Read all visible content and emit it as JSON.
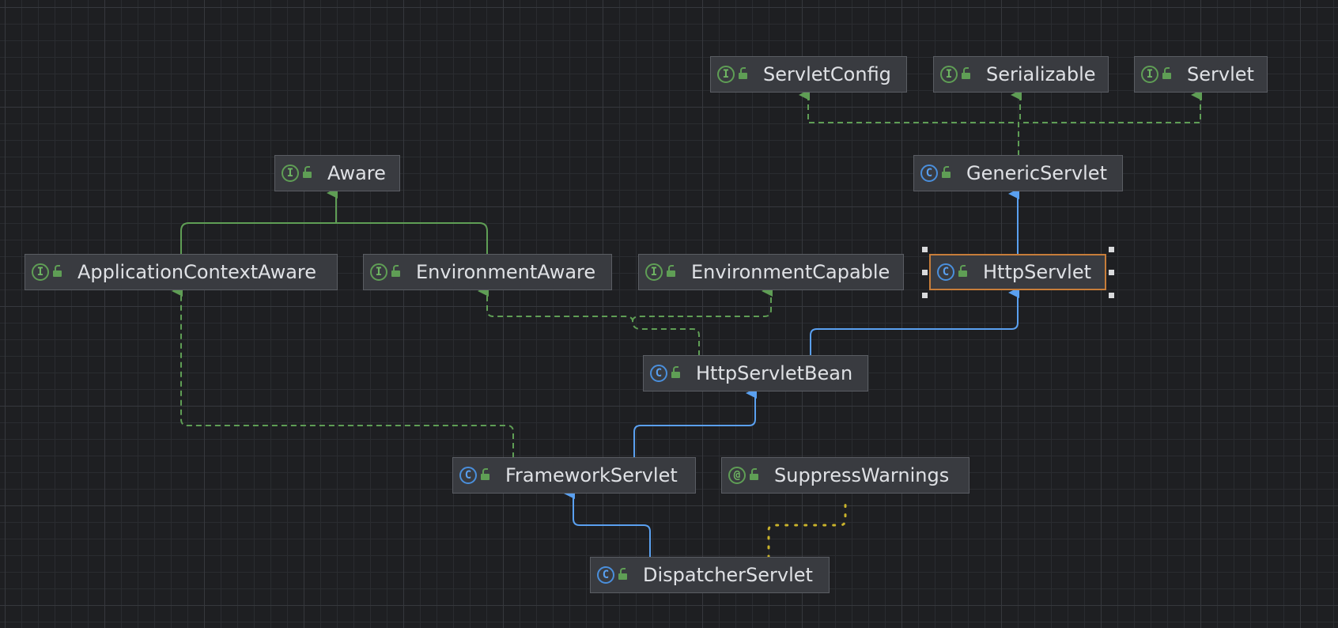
{
  "colors": {
    "interface_edge": "#5f9e55",
    "class_edge": "#5aa0f0",
    "annotation_edge": "#c9b32b",
    "selection": "#c77d3a"
  },
  "nodes": [
    {
      "id": "servletconfig",
      "label": "ServletConfig",
      "kind": "interface",
      "kind_glyph": "I"
    },
    {
      "id": "serializable",
      "label": "Serializable",
      "kind": "interface",
      "kind_glyph": "I"
    },
    {
      "id": "servlet",
      "label": "Servlet",
      "kind": "interface",
      "kind_glyph": "I"
    },
    {
      "id": "aware",
      "label": "Aware",
      "kind": "interface",
      "kind_glyph": "I"
    },
    {
      "id": "genericservlet",
      "label": "GenericServlet",
      "kind": "class",
      "kind_glyph": "C"
    },
    {
      "id": "applicationcontextaware",
      "label": "ApplicationContextAware",
      "kind": "interface",
      "kind_glyph": "I"
    },
    {
      "id": "environmentaware",
      "label": "EnvironmentAware",
      "kind": "interface",
      "kind_glyph": "I"
    },
    {
      "id": "environmentcapable",
      "label": "EnvironmentCapable",
      "kind": "interface",
      "kind_glyph": "I"
    },
    {
      "id": "httpservlet",
      "label": "HttpServlet",
      "kind": "class",
      "kind_glyph": "C",
      "selected": true
    },
    {
      "id": "httpservletbean",
      "label": "HttpServletBean",
      "kind": "class",
      "kind_glyph": "C"
    },
    {
      "id": "frameworkservlet",
      "label": "FrameworkServlet",
      "kind": "class",
      "kind_glyph": "C"
    },
    {
      "id": "suppresswarnings",
      "label": "SuppressWarnings",
      "kind": "annotation",
      "kind_glyph": "@"
    },
    {
      "id": "dispatcherservlet",
      "label": "DispatcherServlet",
      "kind": "class",
      "kind_glyph": "C"
    }
  ],
  "edges": [
    {
      "from": "genericservlet",
      "to": "servletconfig",
      "type": "implements"
    },
    {
      "from": "genericservlet",
      "to": "serializable",
      "type": "implements"
    },
    {
      "from": "genericservlet",
      "to": "servlet",
      "type": "implements"
    },
    {
      "from": "httpservlet",
      "to": "genericservlet",
      "type": "extends"
    },
    {
      "from": "applicationcontextaware",
      "to": "aware",
      "type": "extends-interface"
    },
    {
      "from": "environmentaware",
      "to": "aware",
      "type": "extends-interface"
    },
    {
      "from": "httpservletbean",
      "to": "environmentaware",
      "type": "implements"
    },
    {
      "from": "httpservletbean",
      "to": "environmentcapable",
      "type": "implements"
    },
    {
      "from": "httpservletbean",
      "to": "httpservlet",
      "type": "extends"
    },
    {
      "from": "frameworkservlet",
      "to": "httpservletbean",
      "type": "extends"
    },
    {
      "from": "frameworkservlet",
      "to": "applicationcontextaware",
      "type": "implements"
    },
    {
      "from": "dispatcherservlet",
      "to": "frameworkservlet",
      "type": "extends"
    },
    {
      "from": "dispatcherservlet",
      "to": "suppresswarnings",
      "type": "annotated"
    }
  ]
}
